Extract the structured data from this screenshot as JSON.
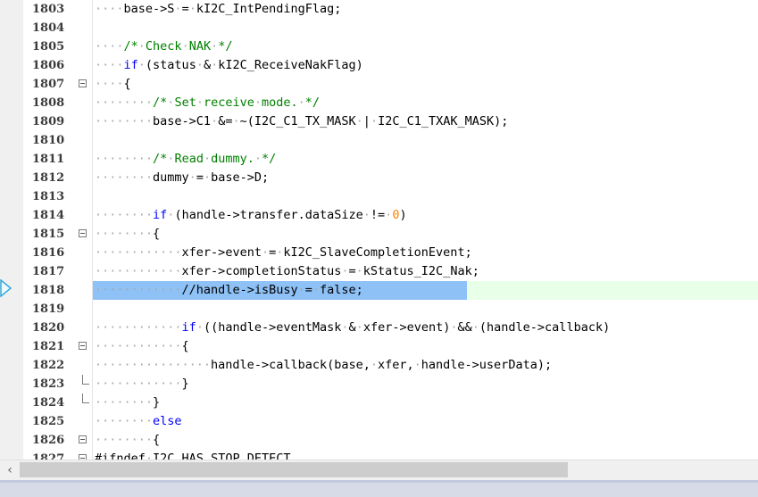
{
  "editor": {
    "colors": {
      "keyword": "#0000ff",
      "comment": "#008000",
      "number": "#ff8000",
      "selection": "#8ec1f5",
      "active_line": "#e8ffe8"
    },
    "current_line_marker": "arrow-right-icon",
    "lines": [
      {
        "n": "1803",
        "fold": "none",
        "indent": 1,
        "tokens": [
          [
            "t",
            "base->S"
          ],
          [
            "t",
            " = "
          ],
          [
            "t",
            "kI2C_IntPendingFlag;"
          ]
        ]
      },
      {
        "n": "1804",
        "fold": "none",
        "indent": 0,
        "tokens": []
      },
      {
        "n": "1805",
        "fold": "none",
        "indent": 1,
        "tokens": [
          [
            "c",
            "/* Check NAK */"
          ]
        ]
      },
      {
        "n": "1806",
        "fold": "none",
        "indent": 1,
        "tokens": [
          [
            "k",
            "if"
          ],
          [
            "t",
            " (status & kI2C_ReceiveNakFlag)"
          ]
        ]
      },
      {
        "n": "1807",
        "fold": "open",
        "indent": 1,
        "tokens": [
          [
            "t",
            "{"
          ]
        ]
      },
      {
        "n": "1808",
        "fold": "none",
        "indent": 2,
        "tokens": [
          [
            "c",
            "/* Set receive mode. */"
          ]
        ]
      },
      {
        "n": "1809",
        "fold": "none",
        "indent": 2,
        "tokens": [
          [
            "t",
            "base->C1 &= ~(I2C_C1_TX_MASK | I2C_C1_TXAK_MASK);"
          ]
        ]
      },
      {
        "n": "1810",
        "fold": "none",
        "indent": 0,
        "tokens": []
      },
      {
        "n": "1811",
        "fold": "none",
        "indent": 2,
        "tokens": [
          [
            "c",
            "/* Read dummy. */"
          ]
        ]
      },
      {
        "n": "1812",
        "fold": "none",
        "indent": 2,
        "tokens": [
          [
            "t",
            "dummy = base->D;"
          ]
        ]
      },
      {
        "n": "1813",
        "fold": "none",
        "indent": 0,
        "tokens": []
      },
      {
        "n": "1814",
        "fold": "none",
        "indent": 2,
        "tokens": [
          [
            "k",
            "if"
          ],
          [
            "t",
            " (handle->transfer.dataSize != "
          ],
          [
            "n",
            "0"
          ],
          [
            "t",
            ")"
          ]
        ]
      },
      {
        "n": "1815",
        "fold": "open",
        "indent": 2,
        "tokens": [
          [
            "t",
            "{"
          ]
        ]
      },
      {
        "n": "1816",
        "fold": "none",
        "indent": 3,
        "tokens": [
          [
            "t",
            "xfer->event = kI2C_SlaveCompletionEvent;"
          ]
        ]
      },
      {
        "n": "1817",
        "fold": "none",
        "indent": 3,
        "tokens": [
          [
            "t",
            "xfer->completionStatus = kStatus_I2C_Nak;"
          ]
        ]
      },
      {
        "n": "1818",
        "fold": "none",
        "indent": 3,
        "active": true,
        "tokens": [
          [
            "t",
            "//handle->isBusy = false;"
          ]
        ]
      },
      {
        "n": "1819",
        "fold": "none",
        "indent": 0,
        "tokens": []
      },
      {
        "n": "1820",
        "fold": "none",
        "indent": 3,
        "tokens": [
          [
            "k",
            "if"
          ],
          [
            "t",
            " ((handle->eventMask & xfer->event) && (handle->callback)"
          ]
        ]
      },
      {
        "n": "1821",
        "fold": "open",
        "indent": 3,
        "tokens": [
          [
            "t",
            "{"
          ]
        ]
      },
      {
        "n": "1822",
        "fold": "none",
        "indent": 4,
        "tokens": [
          [
            "t",
            "handle->callback(base, xfer, handle->userData);"
          ]
        ]
      },
      {
        "n": "1823",
        "fold": "end",
        "indent": 3,
        "tokens": [
          [
            "t",
            "}"
          ]
        ]
      },
      {
        "n": "1824",
        "fold": "end",
        "indent": 2,
        "tokens": [
          [
            "t",
            "}"
          ]
        ]
      },
      {
        "n": "1825",
        "fold": "none",
        "indent": 2,
        "tokens": [
          [
            "k",
            "else"
          ]
        ]
      },
      {
        "n": "1826",
        "fold": "open",
        "indent": 2,
        "tokens": [
          [
            "t",
            "{"
          ]
        ]
      },
      {
        "n": "1827",
        "fold": "open",
        "indent": 0,
        "tokens": [
          [
            "t",
            "#ifndef I2C_HAS_STOP_DETECT"
          ]
        ]
      }
    ]
  },
  "scrollbar": {
    "left_arrow": "‹",
    "left_arrow_icon": "chevron-left-icon"
  }
}
